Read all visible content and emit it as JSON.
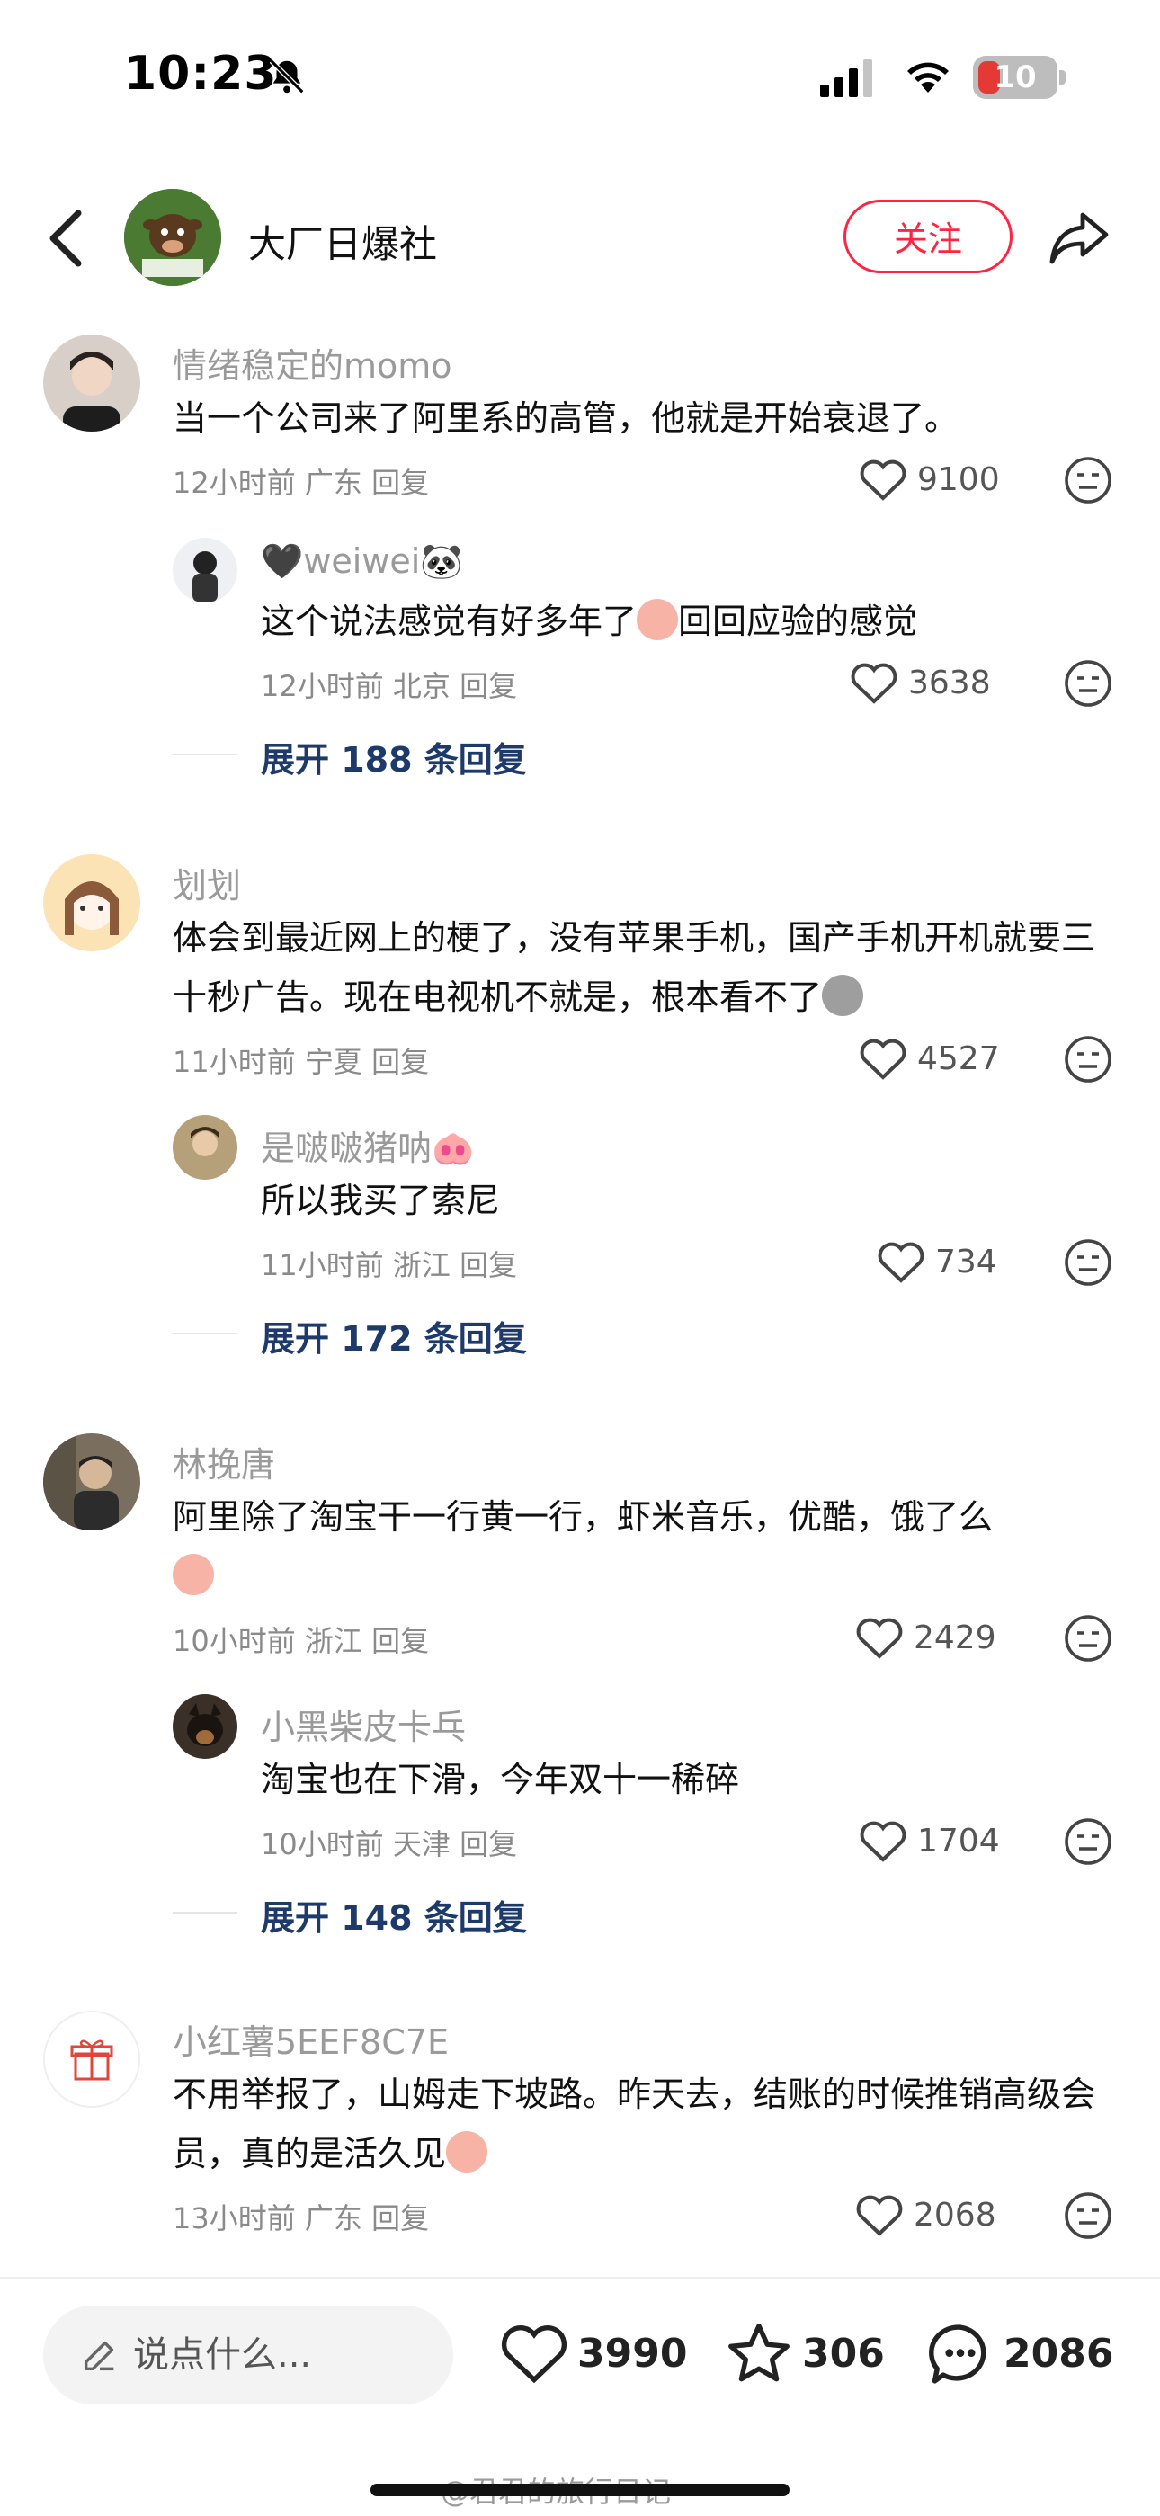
{
  "status_bar": {
    "time": "10:23",
    "battery": "10"
  },
  "header": {
    "account_name": "大厂日爆社",
    "follow_label": "关注",
    "avatar_text": "满十粉防老"
  },
  "comments": [
    {
      "user": "情绪稳定的momo",
      "text": "当一个公司来了阿里系的高管，他就是开始衰退了。",
      "time": "12小时前",
      "location": "广东",
      "reply_label": "回复",
      "likes": "9100",
      "reply": {
        "user": "🖤weiwei🐼",
        "text": "这个说法感觉有好多年了",
        "text_after": "回回应验的感觉",
        "time": "12小时前",
        "location": "北京",
        "reply_label": "回复",
        "likes": "3638"
      },
      "expand": "展开 188 条回复"
    },
    {
      "user": "划划",
      "text": "体会到最近网上的梗了，没有苹果手机，国产手机开机就要三十秒广告。现在电视机不就是，根本看不了",
      "time": "11小时前",
      "location": "宁夏",
      "reply_label": "回复",
      "likes": "4527",
      "reply": {
        "user": "是啵啵猪呐🐽",
        "text": "所以我买了索尼",
        "time": "11小时前",
        "location": "浙江",
        "reply_label": "回复",
        "likes": "734"
      },
      "expand": "展开 172 条回复"
    },
    {
      "user": "林挽唐",
      "text": "阿里除了淘宝干一行黄一行，虾米音乐，优酷，饿了么",
      "time": "10小时前",
      "location": "浙江",
      "reply_label": "回复",
      "likes": "2429",
      "reply": {
        "user": "小黑柴皮卡乓",
        "text": "淘宝也在下滑，今年双十一稀碎",
        "time": "10小时前",
        "location": "天津",
        "reply_label": "回复",
        "likes": "1704"
      },
      "expand": "展开 148 条回复"
    },
    {
      "user": "小红薯5EEF8C7E",
      "text": "不用举报了，山姆走下坡路。昨天去，结账的时候推销高级会员，真的是活久见",
      "time": "13小时前",
      "location": "广东",
      "reply_label": "回复",
      "likes": "2068"
    }
  ],
  "bottom_bar": {
    "input_placeholder": "说点什么...",
    "likes": "3990",
    "favorites": "306",
    "comments": "2086",
    "watermark": "@君君的旅行日记"
  },
  "colors": {
    "accent": "#ff2442",
    "link": "#1e3a6b"
  }
}
